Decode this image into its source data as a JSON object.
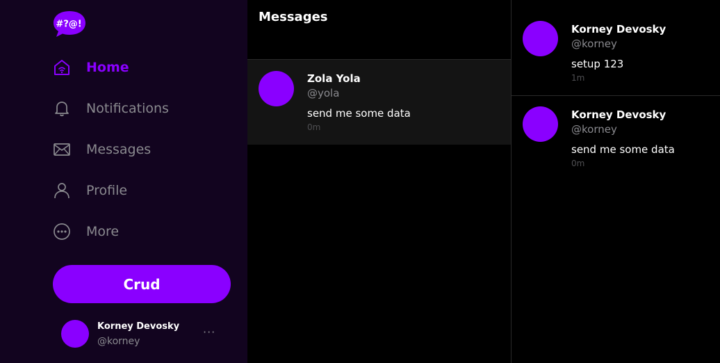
{
  "app": {
    "logo_text": "#?@!"
  },
  "sidebar": {
    "items": [
      {
        "label": "Home",
        "icon": "home-icon",
        "active": true
      },
      {
        "label": "Notifications",
        "icon": "bell-icon",
        "active": false
      },
      {
        "label": "Messages",
        "icon": "mail-icon",
        "active": false
      },
      {
        "label": "Profile",
        "icon": "user-icon",
        "active": false
      },
      {
        "label": "More",
        "icon": "more-circle-icon",
        "active": false
      }
    ],
    "button_label": "Crud",
    "current_user": {
      "name": "Korney Devosky",
      "handle": "@korney",
      "menu": "···"
    }
  },
  "center": {
    "title": "Messages",
    "messages": [
      {
        "name": "Zola Yola",
        "handle": "@yola",
        "text": "send me some data",
        "time": "0m"
      }
    ]
  },
  "right": {
    "messages": [
      {
        "name": "Korney Devosky",
        "handle": "@korney",
        "text": "setup 123",
        "time": "1m"
      },
      {
        "name": "Korney Devosky",
        "handle": "@korney",
        "text": "send me some data",
        "time": "0m"
      }
    ]
  },
  "colors": {
    "accent": "#8a00ff",
    "sidebar_bg": "#12041f",
    "muted": "#8a8a8f"
  }
}
